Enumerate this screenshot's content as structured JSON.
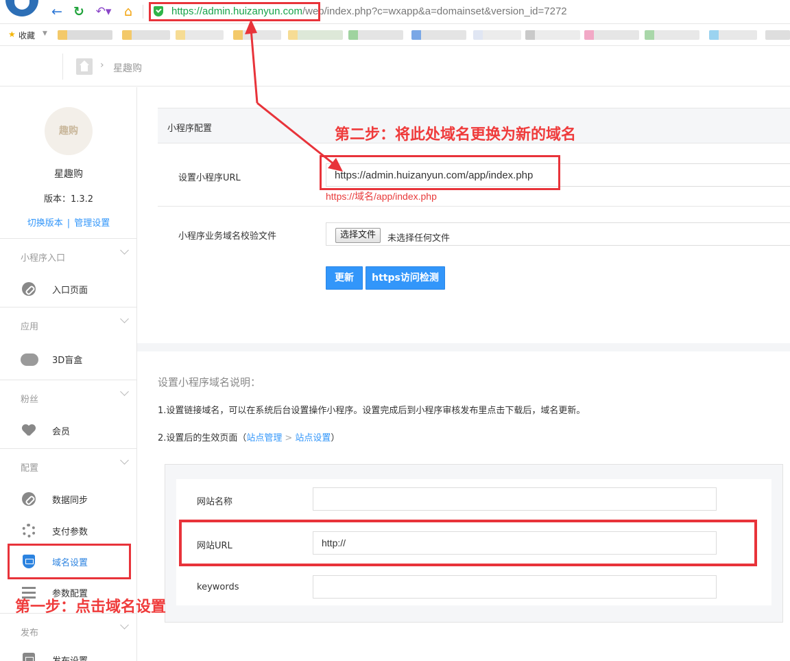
{
  "browser": {
    "url_secure": "https://admin.huizanyun.com",
    "url_rest": "/web/index.php?c=wxapp&a=domainset&version_id=7272",
    "favorites_label": "收藏"
  },
  "breadcrumb": {
    "current": "星趣购"
  },
  "sidebar": {
    "avatar_text": "趣购",
    "app_name": "星趣购",
    "version": "版本：1.3.2",
    "switch_version": "切换版本",
    "manage_settings": "管理设置",
    "sections": [
      {
        "label": "小程序入口",
        "items": [
          {
            "label": "入口页面"
          }
        ]
      },
      {
        "label": "应用",
        "items": [
          {
            "label": "3D盲盒"
          }
        ]
      },
      {
        "label": "粉丝",
        "items": [
          {
            "label": "会员"
          }
        ]
      },
      {
        "label": "配置",
        "items": [
          {
            "label": "数据同步"
          },
          {
            "label": "支付参数"
          },
          {
            "label": "域名设置"
          },
          {
            "label": "参数配置"
          }
        ]
      },
      {
        "label": "发布",
        "items": [
          {
            "label": "发布设置"
          }
        ]
      }
    ]
  },
  "config": {
    "title": "小程序配置",
    "url_label": "设置小程序URL",
    "url_value": "https://admin.huizanyun.com/app/index.php",
    "url_hint": "https://域名/app/index.php",
    "file_label": "小程序业务域名校验文件",
    "file_button": "选择文件",
    "file_status": "未选择任何文件",
    "update_button": "更新",
    "check_button": "https访问检测"
  },
  "description": {
    "title": "设置小程序域名说明：",
    "line1": "1.设置链接域名，可以在系统后台设置操作小程序。设置完成后到小程序审核发布里点击下载后，域名更新。",
    "line2_prefix": "2.设置后的生效页面（",
    "line2_link1": "站点管理",
    "line2_sep": ">",
    "line2_link2": "站点设置",
    "line2_suffix": "）"
  },
  "site_form": {
    "name_label": "网站名称",
    "name_value": "",
    "url_label": "网站URL",
    "url_value": "http://",
    "keywords_label": "keywords",
    "keywords_value": ""
  },
  "annotations": {
    "step1": "第一步：点击域名设置",
    "step2": "第二步：将此处域名更换为新的域名"
  },
  "colors": {
    "accent_blue": "#3296fa",
    "annotation_red": "#e8333a",
    "secure_green": "#16a34a"
  }
}
